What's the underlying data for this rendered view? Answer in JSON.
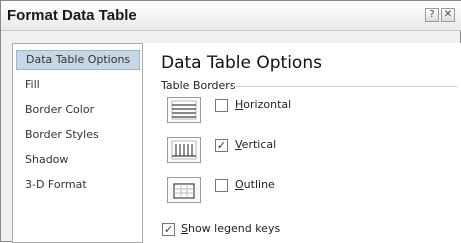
{
  "window": {
    "title": "Format Data Table",
    "help_glyph": "?",
    "close_glyph": "✕"
  },
  "sidebar": {
    "items": [
      {
        "label": "Data Table Options",
        "selected": true
      },
      {
        "label": "Fill",
        "selected": false
      },
      {
        "label": "Border Color",
        "selected": false
      },
      {
        "label": "Border Styles",
        "selected": false
      },
      {
        "label": "Shadow",
        "selected": false
      },
      {
        "label": "3-D Format",
        "selected": false
      }
    ]
  },
  "main": {
    "heading": "Data Table Options",
    "section_label": "Table Borders",
    "options": [
      {
        "key": "H",
        "rest": "orizontal",
        "checked": false,
        "icon": "horizontal-borders-icon"
      },
      {
        "key": "V",
        "rest": "ertical",
        "checked": true,
        "icon": "vertical-borders-icon"
      },
      {
        "key": "O",
        "rest": "utline",
        "checked": false,
        "icon": "outline-border-icon"
      }
    ],
    "legend_option": {
      "key": "S",
      "rest": "how legend keys",
      "checked": true
    },
    "check_glyph": "✓"
  }
}
